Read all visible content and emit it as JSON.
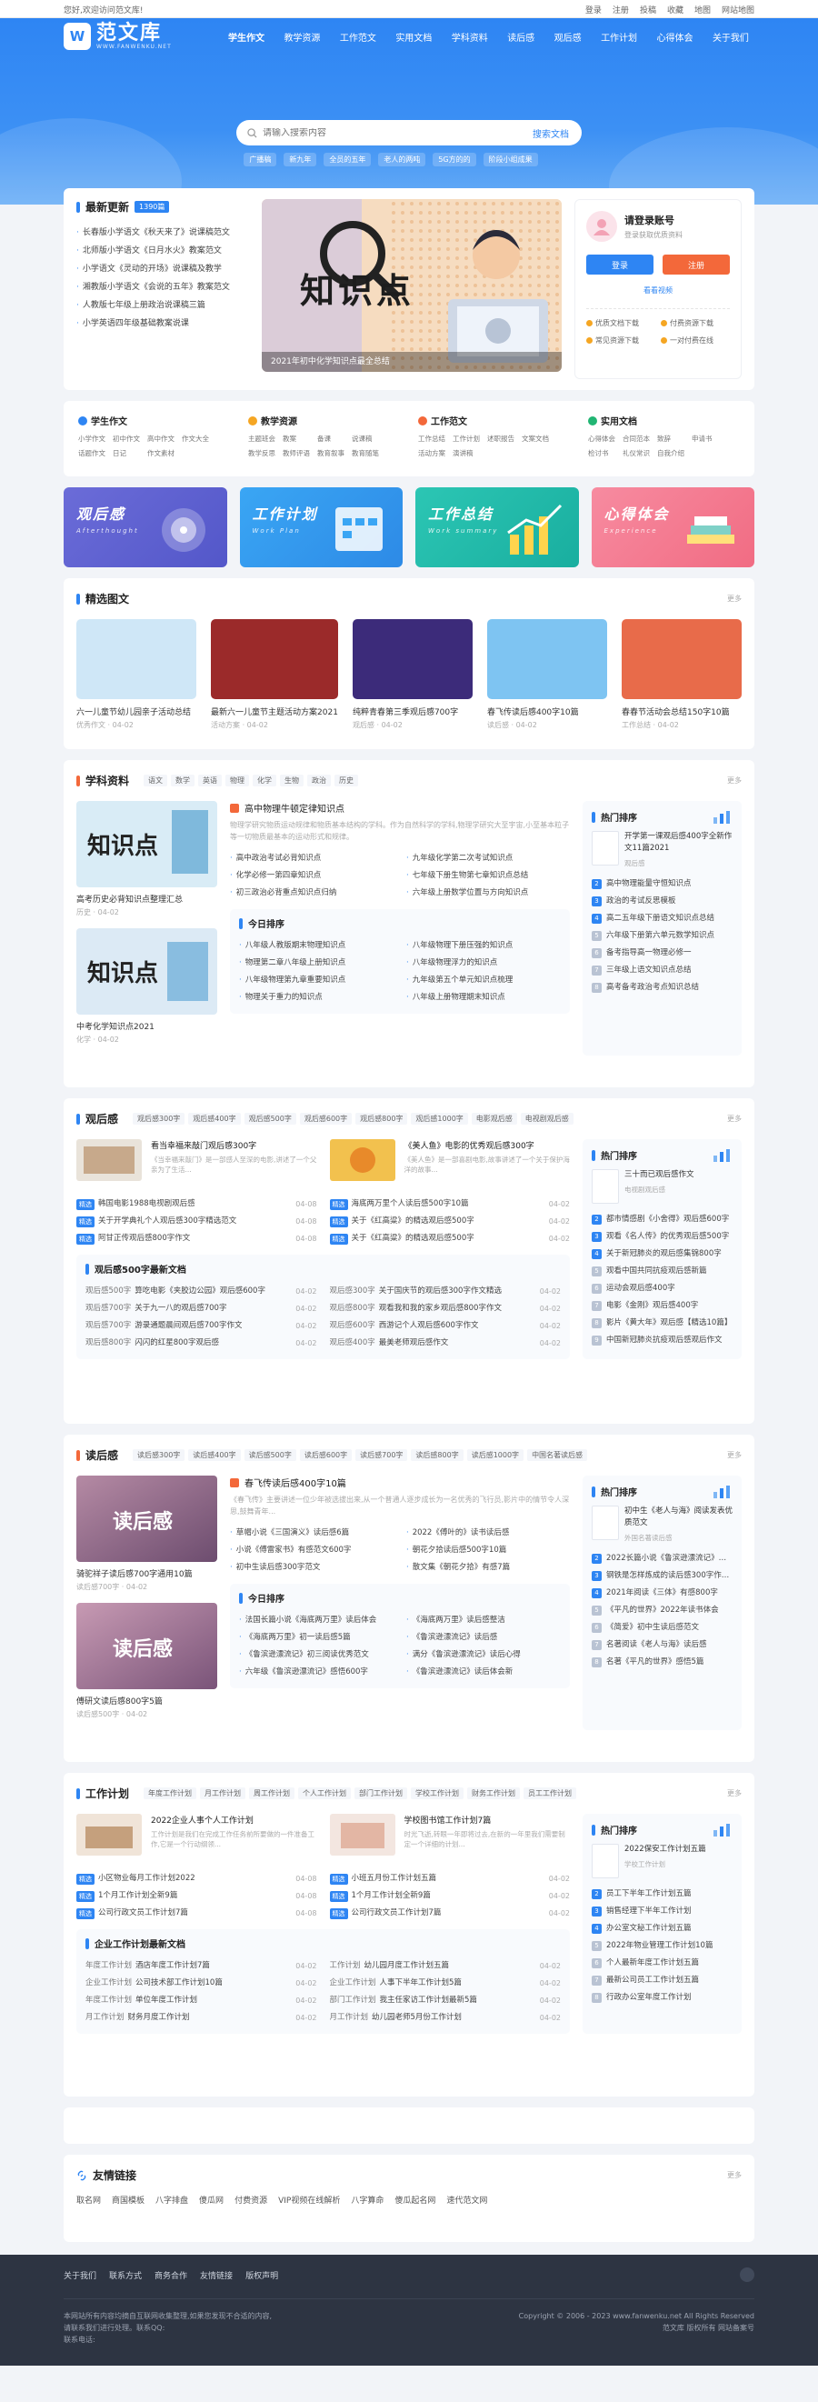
{
  "topbar": {
    "welcome": "您好,欢迎访问范文库!",
    "links": [
      "登录",
      "注册",
      "投稿",
      "收藏",
      "地图",
      "网站地图"
    ]
  },
  "header": {
    "logo_text": "范文库",
    "logo_sub": "WWW.FANWENKU.NET",
    "nav": [
      "学生作文",
      "教学资源",
      "工作范文",
      "实用文档",
      "学科资料",
      "读后感",
      "观后感",
      "工作计划",
      "心得体会",
      "关于我们"
    ],
    "search_placeholder": "请输入搜索内容",
    "search_button": "搜索文档",
    "hotwords": [
      "广播稿",
      "新九年",
      "全员的五年",
      "老人的两吨",
      "5G方的的",
      "阶段小组成果"
    ]
  },
  "latest": {
    "title": "最新更新",
    "badge": "1390篇",
    "items": [
      "长春版小学语文《秋天来了》说课稿范文",
      "北师版小学语文《日月水火》教案范文",
      "小学语文《灵动的开场》说课稿及教学",
      "湘教版小学语文《会说的五年》教案范文",
      "人教版七年级上册政治说课稿三篇",
      "小学英语四年级基础教案说课"
    ]
  },
  "banner": {
    "headline": "知识点",
    "caption": "2021年初中化学知识点最全总结"
  },
  "login_box": {
    "title": "请登录账号",
    "subtitle": "登录获取优质资料",
    "login": "登录",
    "register": "注册",
    "forgot": "看看视频",
    "perks": [
      "优质文档下载",
      "付费资源下载",
      "常见资源下载",
      "一对付费在线"
    ]
  },
  "categories": [
    {
      "name": "学生作文",
      "color": "#2e85f3",
      "links": [
        "小学作文",
        "初中作文",
        "高中作文",
        "作文大全",
        "话题作文",
        "日记",
        "作文素材"
      ]
    },
    {
      "name": "教学资源",
      "color": "#f5a623",
      "links": [
        "主题班会",
        "教案",
        "备课",
        "说课稿",
        "教学反思",
        "教师评语",
        "教育叙事",
        "教育随笔"
      ]
    },
    {
      "name": "工作范文",
      "color": "#f3683a",
      "links": [
        "工作总结",
        "工作计划",
        "述职报告",
        "文案文档",
        "活动方案",
        "演讲稿"
      ]
    },
    {
      "name": "实用文档",
      "color": "#21b573",
      "links": [
        "心得体会",
        "合同范本",
        "致辞",
        "申请书",
        "检讨书",
        "礼仪常识",
        "自我介绍"
      ]
    }
  ],
  "features": [
    {
      "title": "观后感",
      "en": "Afterthought",
      "bg": "linear-gradient(135deg,#6b6cd8,#5357c9)"
    },
    {
      "title": "工作计划",
      "en": "Work Plan",
      "bg": "linear-gradient(135deg,#3aa6f4,#2d8ae6)"
    },
    {
      "title": "工作总结",
      "en": "Work summary",
      "bg": "linear-gradient(135deg,#2cc6b4,#19ae9f)"
    },
    {
      "title": "心得体会",
      "en": "Experience",
      "bg": "linear-gradient(135deg,#f78ba0,#f16c83)"
    }
  ],
  "picks": {
    "title": "精选图文",
    "more": "更多",
    "items": [
      {
        "title": "六一儿童节幼儿园亲子活动总结",
        "meta": "优秀作文 · 04-02",
        "bg": "#cfe7f7"
      },
      {
        "title": "最新六一儿童节主题活动方案2021",
        "meta": "活动方案 · 04-02",
        "bg": "#9b2a2a"
      },
      {
        "title": "纯粹青春第三季观后感700字",
        "meta": "观后感 · 04-02",
        "bg": "#3c2b7a"
      },
      {
        "title": "春飞传读后感400字10篇",
        "meta": "读后感 · 04-02",
        "bg": "#7ec4f2"
      },
      {
        "title": "春春节活动会总结150字10篇",
        "meta": "工作总结 · 04-02",
        "bg": "#e86b4a"
      }
    ]
  },
  "subject": {
    "title": "学科资料",
    "tabs": [
      "语文",
      "数学",
      "英语",
      "物理",
      "化学",
      "生物",
      "政治",
      "历史"
    ],
    "more": "更多",
    "thumbs": [
      {
        "title": "高考历史必背知识点整理汇总",
        "meta": "历史 · 04-02"
      },
      {
        "title": "中考化学知识点2021",
        "meta": "化学 · 04-02"
      }
    ],
    "lead": {
      "title": "高中物理牛顿定律知识点",
      "desc": "物理学研究物质运动规律和物质基本结构的学科。作为自然科学的学科,物理学研究大至宇宙,小至基本粒子等一切物质最基本的运动形式和规律。"
    },
    "list": [
      "高中政治考试必背知识点",
      "九年级化学第二次考试知识点",
      "化学必修一第四章知识点",
      "七年级下册生物第七章知识点总结",
      "初三政治必背重点知识点归纳",
      "六年级上册数学位置与方向知识点"
    ],
    "today_title": "今日排序",
    "today": [
      "八年级人教版期末物理知识点",
      "八年级物理下册压强的知识点",
      "物理第二章八年级上册知识点",
      "八年级物理浮力的知识点",
      "八年级物理第九章重要知识点",
      "九年级第五个单元知识点梳理",
      "物理关于重力的知识点",
      "八年级上册物理期末知识点"
    ],
    "rank_title": "热门排序",
    "rank_top": {
      "title": "开学第一课观后感400字全新作文11篇2021",
      "meta": "观后感"
    },
    "rank": [
      "高中物理能量守恒知识点",
      "政治的考试反思模板",
      "高二五年级下册语文知识点总结",
      "六年级下册第六单元数学知识点",
      "备考指导高一物理必修一",
      "三年级上语文知识点总结",
      "高考备考政治考点知识总结"
    ]
  },
  "review": {
    "title": "观后感",
    "tabs": [
      "观后感300字",
      "观后感400字",
      "观后感500字",
      "观后感600字",
      "观后感800字",
      "观后感1000字",
      "电影观后感",
      "电视剧观后感"
    ],
    "more": "更多",
    "media": [
      {
        "title": "看当幸福来敲门观后感300字",
        "desc": "《当幸福来敲门》是一部感人至深的电影,讲述了一个父亲为了生活..."
      },
      {
        "title": "《美人鱼》电影的优秀观后感300字",
        "desc": "《美人鱼》是一部喜剧电影,故事讲述了一个关于保护海洋的故事..."
      }
    ],
    "list": [
      {
        "t": "韩国电影1988电视剧观后感",
        "d": "04-08"
      },
      {
        "t": "海底两万里个人读后感500字10篇",
        "d": "04-02"
      },
      {
        "t": "关于开学典礼个人观后感300字精选范文",
        "d": "04-08"
      },
      {
        "t": "关于《红高粱》的精选观后感500字",
        "d": "04-02"
      },
      {
        "t": "阿甘正传观后感800字作文",
        "d": "04-08"
      },
      {
        "t": "关于《红高粱》的精选观后感500字",
        "d": "04-02"
      }
    ],
    "sub_title": "观后感500字最新文档",
    "sub": [
      {
        "c": "观后感500字",
        "t": "算吃电影《夹胶边公园》观后感600字",
        "d": "04-02"
      },
      {
        "c": "观后感300字",
        "t": "关于国庆节的观后感300字作文精选",
        "d": "04-02"
      },
      {
        "c": "观后感700字",
        "t": "关于九一八的观后感700字",
        "d": "04-02"
      },
      {
        "c": "观后感800字",
        "t": "观看我和我的家乡观后感800字作文",
        "d": "04-02"
      },
      {
        "c": "观后感700字",
        "t": "游录通题晨间观后感700字作文",
        "d": "04-02"
      },
      {
        "c": "观后感600字",
        "t": "西游记个人观后感600字作文",
        "d": "04-02"
      },
      {
        "c": "观后感800字",
        "t": "闪闪的红星800字观后感",
        "d": "04-02"
      },
      {
        "c": "观后感400字",
        "t": "最美老师观后感作文",
        "d": "04-02"
      }
    ],
    "rank_title": "热门排序",
    "rank_top": {
      "title": "三十而已观后感作文",
      "meta": "电视剧观后感"
    },
    "rank": [
      "都市情感剧《小舍得》观后感600字",
      "观看《名人传》的优秀观后感500字",
      "关于新冠肺炎的观后感集锦800字",
      "观看中国共同抗疫观后感新篇",
      "运动会观后感400字",
      "电影《金刚》观后感400字",
      "影片《黄大年》观后感【精选10篇】",
      "中国新冠肺炎抗疫观后感观后作文"
    ]
  },
  "readings": {
    "title": "读后感",
    "tabs": [
      "读后感300字",
      "读后感400字",
      "读后感500字",
      "读后感600字",
      "读后感700字",
      "读后感800字",
      "读后感1000字",
      "中国名著读后感"
    ],
    "more": "更多",
    "thumbs": [
      {
        "title": "骑驼祥子读后感700字通用10篇",
        "meta": "读后感700字 · 04-02"
      },
      {
        "title": "傅研文读后感800字5篇",
        "meta": "读后感500字 · 04-02"
      }
    ],
    "lead": {
      "title": "春飞传读后感400字10篇",
      "desc": "《春飞传》主要讲述一位少年被选拔出来,从一个普通人逐步成长为一名优秀的飞行员,影片中的情节令人深思,鼓舞青年..."
    },
    "list": [
      "草帽小说《三国演义》读后感6篇",
      "2022《傅叶的》读书读后感",
      "小说《傅雷家书》有感范文600字",
      "朝花夕拾读后感500字10篇",
      "初中生读后感300字范文",
      "散文集《朝花夕拾》有感7篇"
    ],
    "today_title": "今日排序",
    "today": [
      "法国长篇小说《海底两万里》读后体会",
      "《海底两万里》读后感整洁",
      "《海底两万里》初一读后感5篇",
      "《鲁滨逊漂流记》读后感",
      "《鲁滨逊漂流记》初三阅读优秀范文",
      "满分《鲁滨逊漂流记》读后心得",
      "六年级《鲁滨逊漂流记》感悟600字",
      "《鲁滨逊漂流记》读后体会新"
    ],
    "rank_title": "热门排序",
    "rank_top": {
      "title": "初中生《老人与海》阅读发表优质范文",
      "meta": "外国名著读后感"
    },
    "rank": [
      "2022长篇小说《鲁滨逊漂流记》观后",
      "钢铁是怎样炼成的读后感300字作文10篇",
      "2021年阅读《三体》有感800字",
      "《平凡的世界》2022年读书体会",
      "《简爱》初中生读后感范文",
      "名著阅读《老人与海》读后感",
      "名著《平凡的世界》感悟5篇"
    ]
  },
  "plans": {
    "title": "工作计划",
    "tabs": [
      "年度工作计划",
      "月工作计划",
      "周工作计划",
      "个人工作计划",
      "部门工作计划",
      "学校工作计划",
      "财务工作计划",
      "员工工作计划"
    ],
    "more": "更多",
    "media": [
      {
        "title": "2022企业人事个人工作计划",
        "desc": "工作计划是我们在完成工作任务前所要做的一件准备工作,它是一个行动纲领..."
      },
      {
        "title": "学校图书馆工作计划7篇",
        "desc": "时光飞逝,转眼一年即将过去,在新的一年里我们需要制定一个详细的计划..."
      }
    ],
    "list": [
      {
        "t": "小区物业每月工作计划2022",
        "d": "04-08"
      },
      {
        "t": "小班五月份工作计划五篇",
        "d": "04-02"
      },
      {
        "t": "1个月工作计划全新9篇",
        "d": "04-08"
      },
      {
        "t": "1个月工作计划全新9篇",
        "d": "04-02"
      },
      {
        "t": "公司行政文员工作计划7篇",
        "d": "04-08"
      },
      {
        "t": "公司行政文员工作计划7篇",
        "d": "04-02"
      }
    ],
    "sub_title": "企业工作计划最新文档",
    "sub": [
      {
        "c": "年度工作计划",
        "t": "酒店年度工作计划7篇",
        "d": "04-02"
      },
      {
        "c": "工作计划",
        "t": "幼儿园月度工作计划五篇",
        "d": "04-02"
      },
      {
        "c": "企业工作计划",
        "t": "公司技术部工作计划10篇",
        "d": "04-02"
      },
      {
        "c": "企业工作计划",
        "t": "人事下半年工作计划5篇",
        "d": "04-02"
      },
      {
        "c": "年度工作计划",
        "t": "单位年度工作计划",
        "d": "04-02"
      },
      {
        "c": "部门工作计划",
        "t": "我主任家访工作计划最新5篇",
        "d": "04-02"
      },
      {
        "c": "月工作计划",
        "t": "财务月度工作计划",
        "d": "04-02"
      },
      {
        "c": "月工作计划",
        "t": "幼儿园老师5月份工作计划",
        "d": "04-02"
      }
    ],
    "rank_title": "热门排序",
    "rank_top": {
      "title": "2022保安工作计划五篇",
      "meta": "学校工作计划"
    },
    "rank": [
      "员工下半年工作计划五篇",
      "销售经理下半年工作计划",
      "办公室文秘工作计划五篇",
      "2022年物业管理工作计划10篇",
      "个人最新年度工作计划五篇",
      "最新公司员工工作计划五篇",
      "行政办公室年度工作计划"
    ]
  },
  "friends": {
    "title": "友情链接",
    "more": "更多",
    "links": [
      "取名网",
      "商国模板",
      "八字排盘",
      "傻瓜网",
      "付费资源",
      "VIP视频在线解析",
      "八字算命",
      "傻瓜起名网",
      "速代范文网"
    ]
  },
  "footer": {
    "links": [
      "关于我们",
      "联系方式",
      "商务合作",
      "友情链接",
      "版权声明"
    ],
    "left": [
      "本网站所有内容均摘自互联网收集整理,如果您发现不合适的内容,",
      "请联系我们进行处理。联系QQ:",
      "联系电话:"
    ],
    "right": [
      "Copyright © 2006 - 2023 www.fanwenku.net All Rights Reserved",
      "范文库 版权所有 网站备案号"
    ]
  }
}
